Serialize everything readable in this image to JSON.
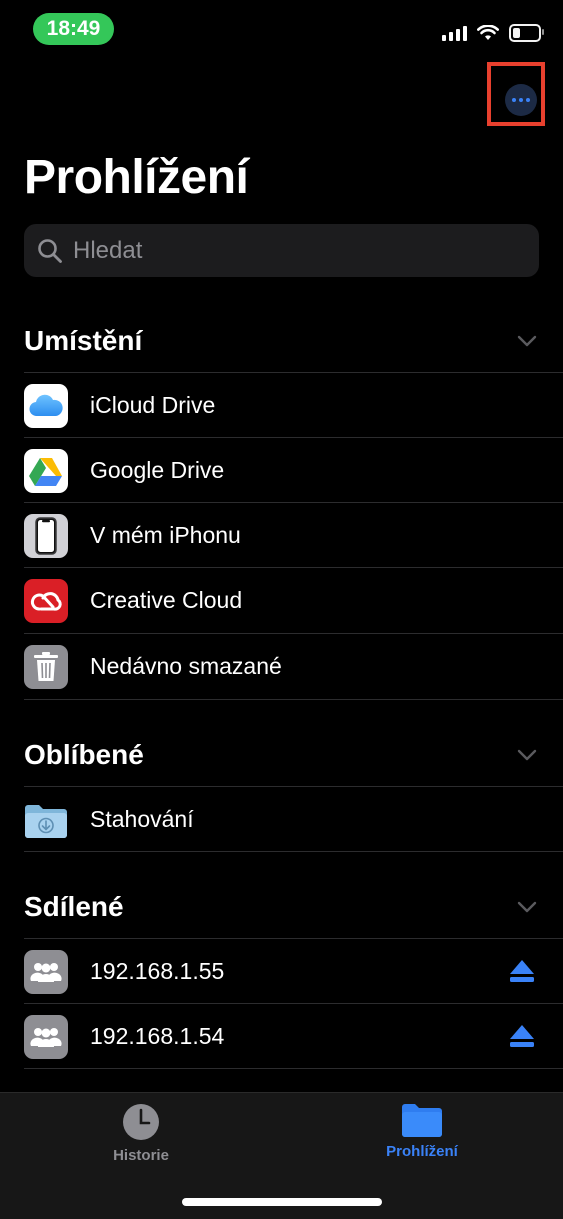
{
  "status": {
    "time": "18:49"
  },
  "header": {
    "title": "Prohlížení"
  },
  "search": {
    "placeholder": "Hledat"
  },
  "sections": {
    "locations": {
      "title": "Umístění",
      "items": [
        "iCloud Drive",
        "Google Drive",
        "V mém iPhonu",
        "Creative Cloud",
        "Nedávno smazané"
      ]
    },
    "favorites": {
      "title": "Oblíbené",
      "items": [
        "Stahování"
      ]
    },
    "shared": {
      "title": "Sdílené",
      "items": [
        "192.168.1.55",
        "192.168.1.54"
      ]
    }
  },
  "tabbar": {
    "history_label": "Historie",
    "browse_label": "Prohlížení"
  },
  "colors": {
    "accent": "#3a82f7",
    "highlight": "#e8402e",
    "status_green": "#34c759"
  }
}
